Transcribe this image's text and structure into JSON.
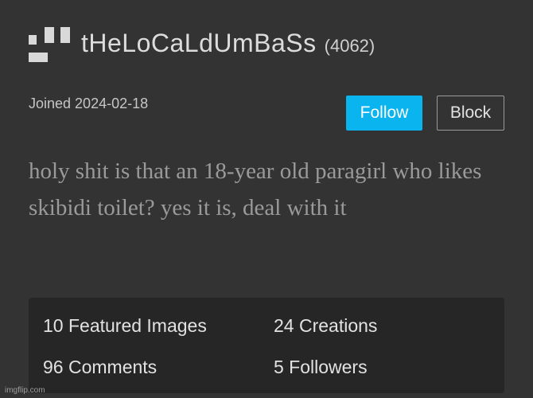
{
  "profile": {
    "username": "tHeLoCaLdUmBaSs",
    "points": "(4062)",
    "joined": "Joined 2024-02-18",
    "bio": "holy shit is that an 18-year old paragirl who likes skibidi toilet? yes it is, deal with it"
  },
  "actions": {
    "follow_label": "Follow",
    "block_label": "Block"
  },
  "stats": {
    "featured_images": "10 Featured Images",
    "creations": "24 Creations",
    "comments": "96 Comments",
    "followers": "5 Followers"
  },
  "watermark": "imgflip.com",
  "colors": {
    "background": "#333333",
    "accent": "#0ab4ef",
    "stats_panel": "#262626"
  },
  "icons": {
    "avatar": "default-avatar-icon"
  }
}
